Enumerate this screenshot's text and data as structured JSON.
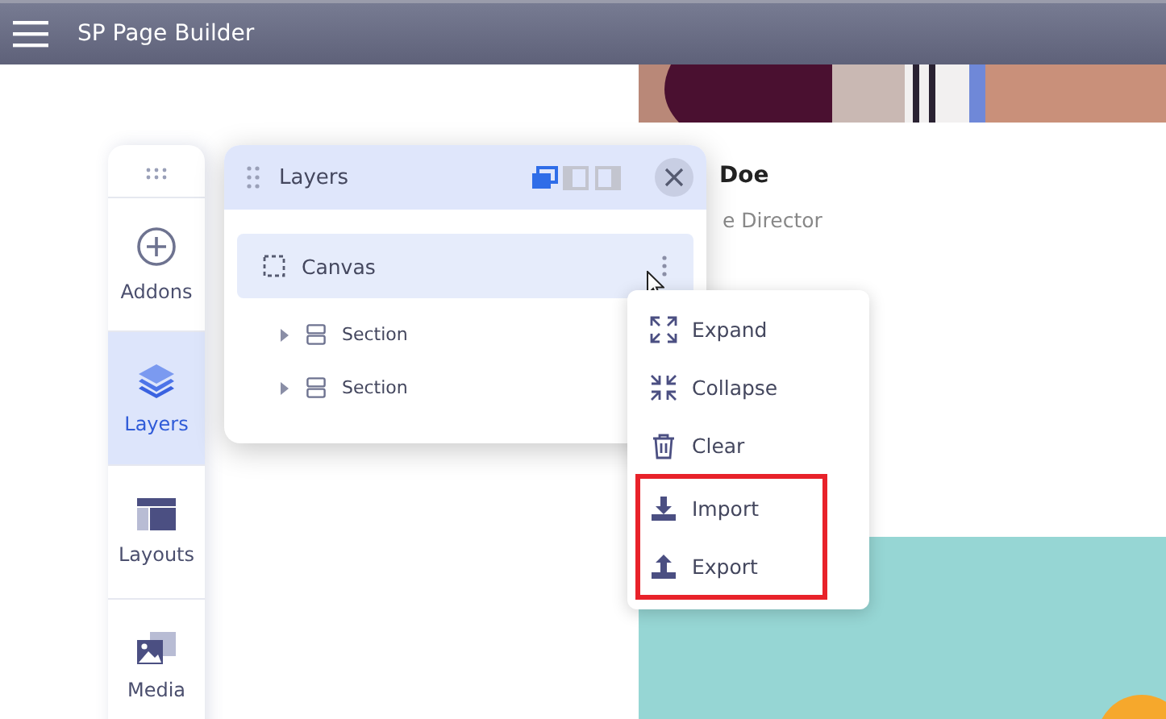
{
  "header": {
    "title": "SP Page Builder"
  },
  "page": {
    "name": "Doe",
    "role": "e Director"
  },
  "sidebar": {
    "items": [
      {
        "kind": "addons",
        "label": "Addons",
        "selected": false
      },
      {
        "kind": "layers",
        "label": "Layers",
        "selected": true
      },
      {
        "kind": "layouts",
        "label": "Layouts",
        "selected": false
      },
      {
        "kind": "media",
        "label": "Media",
        "selected": false
      }
    ]
  },
  "layers_panel": {
    "title": "Layers",
    "view_modes": [
      {
        "kind": "floating",
        "selected": true
      },
      {
        "kind": "left",
        "selected": false
      },
      {
        "kind": "right",
        "selected": false
      }
    ],
    "tree": [
      {
        "label": "Canvas",
        "selected": true,
        "children": [
          {
            "label": "Section",
            "kind": "section",
            "expanded": false,
            "selected": false
          },
          {
            "label": "Section",
            "kind": "section",
            "expanded": false,
            "selected": false
          }
        ]
      }
    ]
  },
  "context_menu": {
    "items": [
      {
        "kind": "expand",
        "label": "Expand",
        "highlighted": false
      },
      {
        "kind": "collapse",
        "label": "Collapse",
        "highlighted": false
      },
      {
        "kind": "clear",
        "label": "Clear",
        "highlighted": false
      },
      {
        "kind": "import",
        "label": "Import",
        "highlighted": true
      },
      {
        "kind": "export",
        "label": "Export",
        "highlighted": true
      }
    ]
  }
}
